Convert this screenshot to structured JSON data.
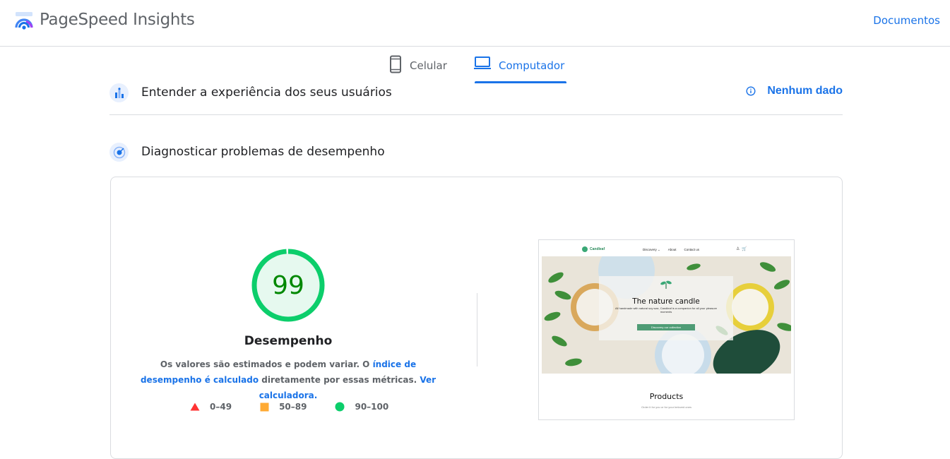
{
  "header": {
    "brand": "PageSpeed Insights",
    "docs_link": "Documentos"
  },
  "tabs": [
    {
      "label": "Celular",
      "icon": "smartphone-icon",
      "active": false
    },
    {
      "label": "Computador",
      "icon": "laptop-icon",
      "active": true
    }
  ],
  "field_data": {
    "title": "Entender a experiência dos seus usuários",
    "status": "Nenhum dado"
  },
  "lab_data": {
    "title": "Diagnosticar problemas de desempenho"
  },
  "performance": {
    "score": "99",
    "score_value": 0.99,
    "title": "Desempenho",
    "desc_part1": "Os valores são estimados e podem variar. O ",
    "desc_link1": "índice de desempenho é calculado",
    "desc_part2": " diretamente por essas métricas. ",
    "desc_link2": "Ver calculadora.",
    "legend": [
      {
        "label": "0–49",
        "shape": "triangle",
        "color": "#ff3333"
      },
      {
        "label": "50–89",
        "shape": "square",
        "color": "#ffaa33"
      },
      {
        "label": "90–100",
        "shape": "circle",
        "color": "#0cce6b"
      }
    ],
    "colors": {
      "good": "#0cce6b",
      "good_bg": "#e6f9ef",
      "good_text": "#008800"
    }
  },
  "screenshot": {
    "brand": "Candleaf",
    "nav_links": [
      "Discovery ⌄",
      "About",
      "Contact us"
    ],
    "hero_title": "The nature candle",
    "hero_subtitle": "All handmade with natural soy wax, Candleaf is a companion for all your pleasure moments",
    "hero_button": "Discovery our collection",
    "section_title": "Products",
    "section_subtitle": "Order it for you or for your beloved ones"
  }
}
